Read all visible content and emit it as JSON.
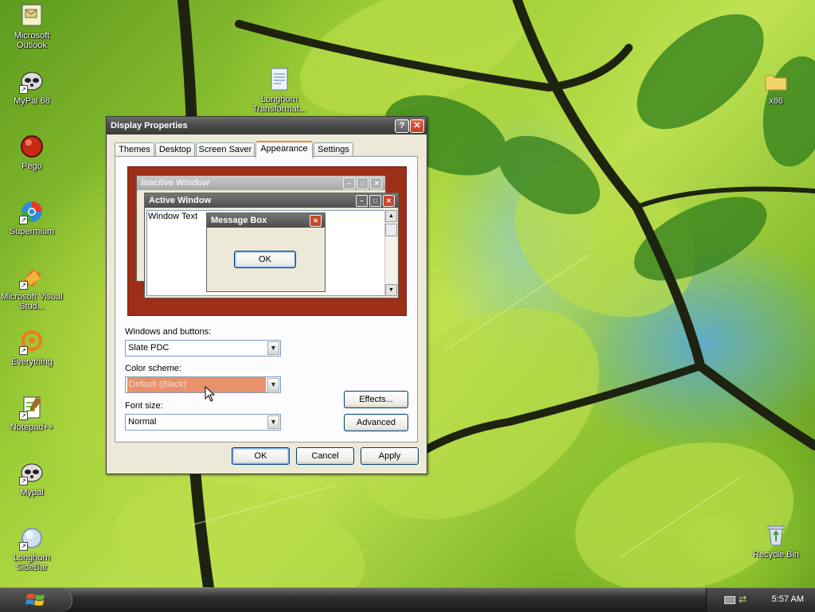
{
  "desktop": {
    "icons_left": [
      {
        "label": "Microsoft Outlook",
        "icon": "outlook-icon"
      },
      {
        "label": "MyPal 68",
        "icon": "mypal-icon"
      },
      {
        "label": "Pego",
        "icon": "pego-icon"
      },
      {
        "label": "Supermium",
        "icon": "supermium-icon"
      },
      {
        "label": "Microsoft Visual Stud...",
        "icon": "visual-studio-icon"
      },
      {
        "label": "Everything",
        "icon": "everything-icon"
      },
      {
        "label": "Notepad++",
        "icon": "notepadpp-icon"
      },
      {
        "label": "Mypal",
        "icon": "mypal-icon"
      },
      {
        "label": "Longhorn SideBar",
        "icon": "sidebar-icon"
      }
    ],
    "icon_longhorn": {
      "label": "Longhorn Transformat...",
      "icon": "document-icon"
    },
    "icon_x86": {
      "label": "x86",
      "icon": "folder-icon"
    },
    "icon_recycle": {
      "label": "Recycle Bin",
      "icon": "recycle-bin-icon"
    }
  },
  "window": {
    "title": "Display Properties",
    "help_glyph": "?",
    "close_glyph": "✕",
    "tabs": [
      "Themes",
      "Desktop",
      "Screen Saver",
      "Appearance",
      "Settings"
    ],
    "active_tab": "Appearance",
    "preview": {
      "inactive_title": "Inactive Window",
      "active_title": "Active Window",
      "window_text": "Window Text",
      "message_title": "Message Box",
      "message_ok": "OK"
    },
    "windows_buttons": {
      "label": "Windows and buttons:",
      "value": "Slate PDC"
    },
    "color_scheme": {
      "label": "Color scheme:",
      "value": "Default (Black)"
    },
    "font_size": {
      "label": "Font size:",
      "value": "Normal"
    },
    "effects_label": "Effects...",
    "advanced_label": "Advanced",
    "ok_label": "OK",
    "cancel_label": "Cancel",
    "apply_label": "Apply"
  },
  "taskbar": {
    "clock": "5:57 AM"
  },
  "colors": {
    "preview_background": "#9e2e18",
    "color_scheme_highlight": "#e8916b",
    "tab_accent": "#e68b2c"
  }
}
